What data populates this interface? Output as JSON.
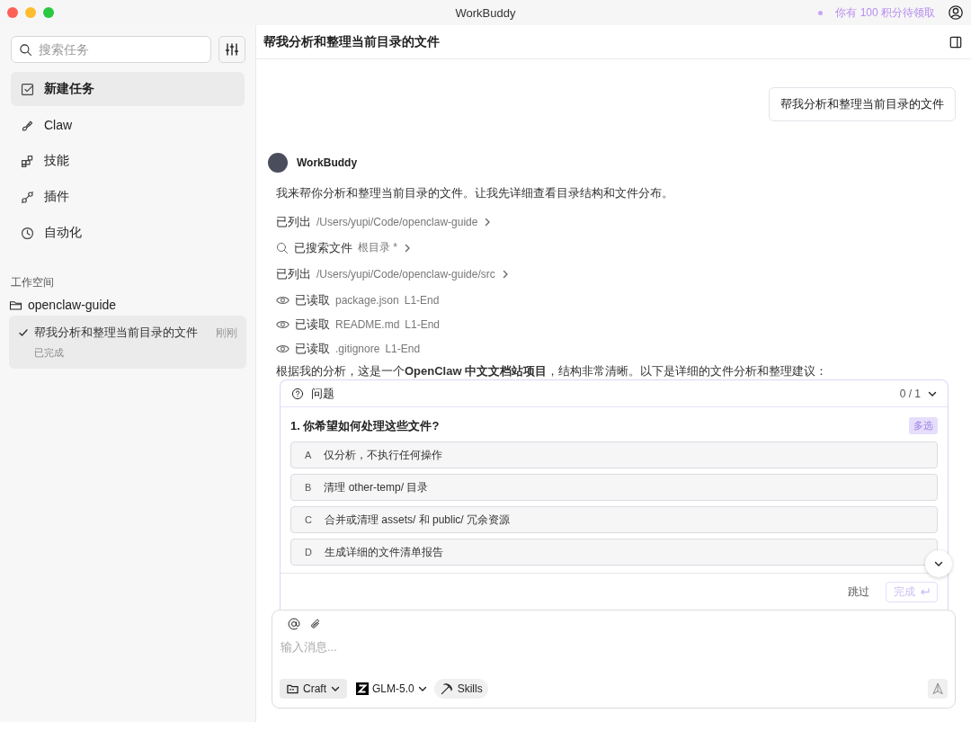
{
  "window": {
    "title": "WorkBuddy"
  },
  "title_bar": {
    "points_notice": "你有 100 积分待领取"
  },
  "sidebar": {
    "search": {
      "placeholder": "搜索任务"
    },
    "nav": [
      {
        "label": "新建任务",
        "selected": true
      },
      {
        "label": "Claw",
        "selected": false
      },
      {
        "label": "技能",
        "selected": false
      },
      {
        "label": "插件",
        "selected": false
      },
      {
        "label": "自动化",
        "selected": false
      }
    ],
    "workspace_heading": "工作空间",
    "workspace": {
      "name": "openclaw-guide",
      "tasks": [
        {
          "title": "帮我分析和整理当前目录的文件",
          "status": "已完成",
          "time": "刚刚",
          "done": true,
          "selected": true
        }
      ]
    }
  },
  "chat": {
    "title": "帮我分析和整理当前目录的文件",
    "user_message": "帮我分析和整理当前目录的文件",
    "assistant": {
      "name": "WorkBuddy",
      "intro": "我来帮你分析和整理当前目录的文件。让我先详细查看目录结构和文件分布。",
      "steps": [
        {
          "kind": "list",
          "action": "已列出",
          "target": "/Users/yupi/Code/openclaw-guide"
        },
        {
          "kind": "search",
          "action": "已搜索文件",
          "target": "根目录 *"
        },
        {
          "kind": "list",
          "action": "已列出",
          "target": "/Users/yupi/Code/openclaw-guide/src"
        },
        {
          "kind": "read",
          "action": "已读取",
          "target": "package.json",
          "range": "L1-End"
        },
        {
          "kind": "read",
          "action": "已读取",
          "target": "README.md",
          "range": "L1-End"
        },
        {
          "kind": "read",
          "action": "已读取",
          "target": ".gitignore",
          "range": "L1-End"
        }
      ],
      "summary": "根据我的分析，这是一个**OpenClaw 中文文档站项目**，结构非常清晰。以下是详细的文件分析和整理建议："
    }
  },
  "question_panel": {
    "title": "问题",
    "progress": "0 / 1",
    "question": "1. 你希望如何处理这些文件?",
    "badge": "多选",
    "options": [
      {
        "letter": "A",
        "text": "仅分析，不执行任何操作",
        "selected": false
      },
      {
        "letter": "B",
        "text": "清理 other-temp/ 目录",
        "selected": false
      },
      {
        "letter": "C",
        "text": "合并或清理 assets/ 和 public/ 冗余资源",
        "selected": false
      },
      {
        "letter": "D",
        "text": "生成详细的文件清单报告",
        "selected": false
      }
    ],
    "skip": "跳过",
    "submit": "完成",
    "submit_disabled": true
  },
  "composer": {
    "placeholder": "输入消息...",
    "mode": "Craft",
    "model": "GLM-5.0",
    "skills": "Skills"
  }
}
